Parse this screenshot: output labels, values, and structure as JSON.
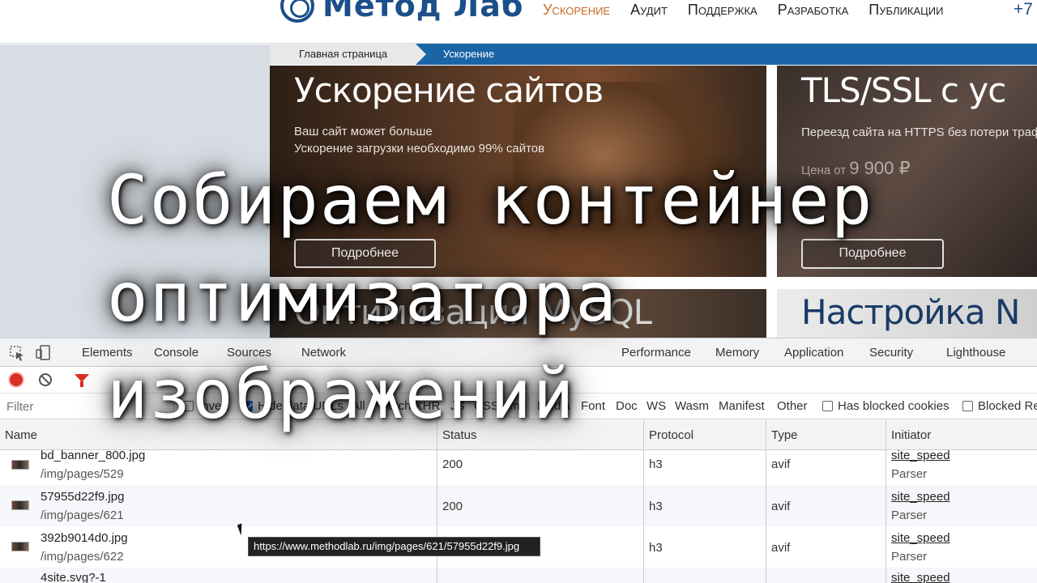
{
  "site": {
    "logo_text": "Метод Лаб",
    "nav": [
      "Ускорение",
      "Аудит",
      "Поддержка",
      "Разработка",
      "Публикации"
    ],
    "nav_active": 0,
    "phone": "+7",
    "breadcrumb": {
      "home": "Главная страница",
      "current": "Ускорение"
    },
    "banners": [
      {
        "title": "Ускорение сайтов",
        "sub1": "Ваш сайт может больше",
        "sub2": "Ускорение загрузки необходимо 99% сайтов",
        "button": "Подробнее"
      },
      {
        "title": "TLS/SSL с ус",
        "sub1": "Переезд сайта на HTTPS без потери траф",
        "price_prefix": "Цена от",
        "price": "9 900 ₽",
        "button": "Подробнее"
      },
      {
        "title": "Оптимизация MySQL"
      },
      {
        "title": "Настройка N"
      }
    ]
  },
  "devtools": {
    "tabs": [
      "Elements",
      "Console",
      "Sources",
      "Network",
      "Performance",
      "Memory",
      "Application",
      "Security",
      "Lighthouse"
    ],
    "filter_placeholder": "Filter",
    "filter_options": {
      "invert": "Invert",
      "hide_data_urls": "Hide data URLs"
    },
    "types": [
      "All",
      "Fetch/XHR",
      "JS",
      "CSS",
      "Img",
      "Media",
      "Font",
      "Doc",
      "WS",
      "Wasm",
      "Manifest",
      "Other"
    ],
    "types_selected": "Img",
    "extra_options": [
      "Has blocked cookies",
      "Blocked Re"
    ],
    "columns": [
      "Name",
      "Status",
      "Protocol",
      "Type",
      "Initiator"
    ],
    "rows": [
      {
        "name": "bd_banner_800.jpg",
        "path": "/img/pages/529",
        "status": "200",
        "protocol": "h3",
        "type": "avif",
        "initiator": "site_speed",
        "initiator_type": "Parser"
      },
      {
        "name": "57955d22f9.jpg",
        "path": "/img/pages/621",
        "status": "200",
        "protocol": "h3",
        "type": "avif",
        "initiator": "site_speed",
        "initiator_type": "Parser"
      },
      {
        "name": "392b9014d0.jpg",
        "path": "/img/pages/622",
        "status": "",
        "protocol": "h3",
        "type": "avif",
        "initiator": "site_speed",
        "initiator_type": "Parser"
      },
      {
        "name": "4site.svg?-1",
        "path": "",
        "status": "",
        "protocol": "",
        "type": "",
        "initiator": "site_speed",
        "initiator_type": ""
      }
    ],
    "tooltip": "https://www.methodlab.ru/img/pages/621/57955d22f9.jpg"
  },
  "overlay_caption": [
    "Собираем контейнер",
    "оптимизатора",
    "изображений"
  ],
  "colors": {
    "brand_blue": "#1b4f8a",
    "nav_active": "#c96a24",
    "breadcrumb_bar": "#1a64a8",
    "record_red": "#d93025",
    "checkbox_blue": "#1a73e8"
  }
}
